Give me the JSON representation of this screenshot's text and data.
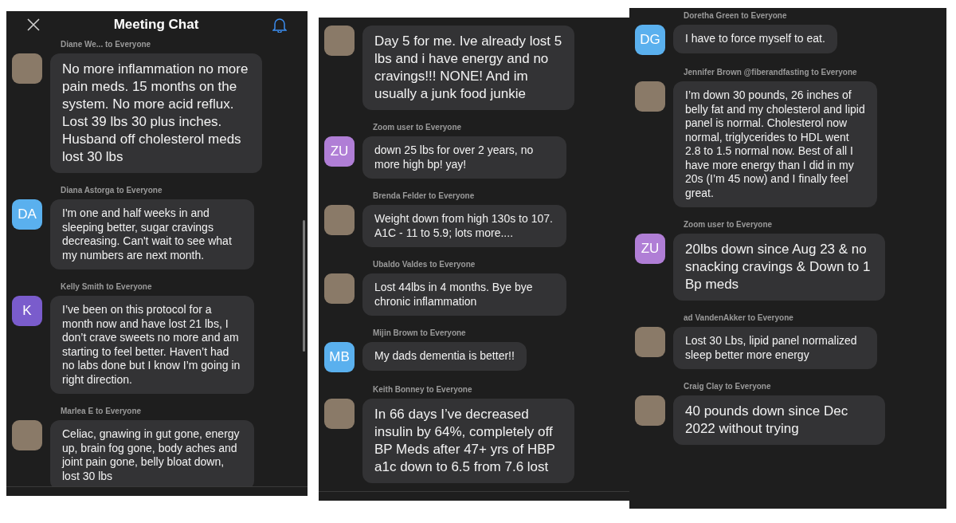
{
  "panels": [
    {
      "header": {
        "title": "Meeting Chat"
      },
      "scrollbar": true,
      "footer": true,
      "messages": [
        {
          "sender": "Diane We... to Everyone",
          "avatar": {
            "kind": "photo"
          },
          "large": true,
          "text": "No more inflammation no more pain meds. 15 months on the system. No more acid reflux. Lost 39 lbs 30 plus inches. Husband off cholesterol meds lost 30 lbs"
        },
        {
          "sender": "Diana Astorga to Everyone",
          "avatar": {
            "kind": "initials",
            "initials": "DA",
            "color": "#5ab0ee"
          },
          "large": false,
          "text": "I'm one and half weeks in and sleeping better, sugar cravings decreasing. Can't wait to see what my numbers are next month."
        },
        {
          "sender": "Kelly Smith to Everyone",
          "avatar": {
            "kind": "initials",
            "initials": "K",
            "color": "#7a5ccc"
          },
          "large": false,
          "text": "I’ve been on this protocol for a month now and have lost 21 lbs, I don’t crave sweets no more and am starting to feel better. Haven’t had no labs done but I know I’m going in right direction."
        },
        {
          "sender": "Marlea E to Everyone",
          "avatar": {
            "kind": "photo"
          },
          "large": false,
          "text": "Celiac, gnawing in gut gone, energy up, brain fog gone, body aches and joint pain gone, belly bloat down, lost 30 lbs"
        }
      ]
    },
    {
      "scrollbar": false,
      "footer": true,
      "messages": [
        {
          "avatar": {
            "kind": "photo"
          },
          "large": true,
          "text": "Day 5 for me. Ive already lost 5 lbs and i have energy and no cravings!!! NONE! And im usually a junk food junkie"
        },
        {
          "sender": "Zoom user to Everyone",
          "avatar": {
            "kind": "initials",
            "initials": "ZU",
            "color": "#b07ed6"
          },
          "large": false,
          "text": "down 25 lbs for over 2 years, no more high bp! yay!"
        },
        {
          "sender": "Brenda Felder to Everyone",
          "avatar": {
            "kind": "photo"
          },
          "large": false,
          "text": "Weight down from high 130s to 107. A1C - 11 to 5.9; lots more...."
        },
        {
          "sender": "Ubaldo Valdes to Everyone",
          "avatar": {
            "kind": "photo"
          },
          "large": false,
          "text": "Lost 44lbs in 4 months. Bye bye chronic inflammation"
        },
        {
          "sender": "Mijin Brown to Everyone",
          "avatar": {
            "kind": "initials",
            "initials": "MB",
            "color": "#5ab0ee"
          },
          "large": false,
          "text": "My dads dementia is better!!"
        },
        {
          "sender": "Keith Bonney to Everyone",
          "avatar": {
            "kind": "photo"
          },
          "large": true,
          "text": "In 66 days I’ve decreased insulin by 64%, completely off BP Meds after 47+ yrs of HBP a1c down to 6.5 from 7.6 lost"
        }
      ]
    },
    {
      "scrollbar": false,
      "footer": false,
      "messages": [
        {
          "sender": "Doretha Green to Everyone",
          "avatar": {
            "kind": "initials",
            "initials": "DG",
            "color": "#5ab0ee"
          },
          "large": false,
          "text": "I have to force myself to eat."
        },
        {
          "sender": "Jennifer Brown @fiberandfasting to Everyone",
          "avatar": {
            "kind": "photo"
          },
          "large": false,
          "text": "I’m down 30 pounds, 26 inches of belly fat and my cholesterol and lipid panel is normal.  Cholesterol now normal, triglycerides to HDL went 2.8 to 1.5 normal now. Best of all I have more energy than I did in my 20s (I’m 45 now) and I finally feel great."
        },
        {
          "sender": "Zoom user to Everyone",
          "avatar": {
            "kind": "initials",
            "initials": "ZU",
            "color": "#b07ed6"
          },
          "large": true,
          "text": "20lbs down since Aug 23 & no snacking cravings & Down to 1 Bp meds"
        },
        {
          "sender": "ad VandenAkker to Everyone",
          "avatar": {
            "kind": "photo"
          },
          "large": false,
          "text": "Lost 30 Lbs, lipid panel normalized sleep better more energy"
        },
        {
          "sender": "Craig Clay to Everyone",
          "avatar": {
            "kind": "photo"
          },
          "large": true,
          "text": "40 pounds down since Dec 2022 without trying"
        }
      ]
    }
  ]
}
